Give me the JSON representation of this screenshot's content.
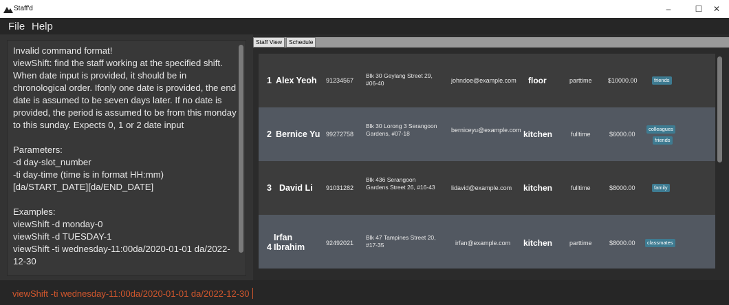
{
  "window": {
    "title": "Staff'd",
    "controls": [
      "–",
      "☐",
      "✕"
    ]
  },
  "menu": {
    "items": [
      "File",
      "Help"
    ]
  },
  "result": {
    "text": "Invalid command format!\nviewShift: find the staff working at the specified shift. When date input is provided, it should be in chronological order. Ifonly one date is provided, the end date is assumed to be seven days later. If no date is provided, the period is assumed to be from this monday to this sunday. Expects 0, 1 or 2 date input\n\nParameters:\n-d day-slot_number\n-ti day-time (time is in format HH:mm)[da/START_DATE][da/END_DATE]\n\nExamples:\nviewShift -d monday-0\nviewShift -d TUESDAY-1\nviewShift -ti wednesday-11:00da/2020-01-01 da/2022-12-30"
  },
  "tabs": [
    {
      "label": "Staff View"
    },
    {
      "label": "Schedule"
    }
  ],
  "staff": [
    {
      "index": "1",
      "name": "Alex Yeoh",
      "phone": "91234567",
      "address": "Blk 30 Geylang Street 29, #06-40",
      "email": "johndoe@example.com",
      "role": "floor",
      "type": "parttime",
      "salary": "$10000.00",
      "tags": [
        "friends"
      ]
    },
    {
      "index": "2",
      "name": "Bernice Yu",
      "phone": "99272758",
      "address": "Blk 30 Lorong 3 Serangoon Gardens, #07-18",
      "email": "berniceyu@example.com",
      "role": "kitchen",
      "type": "fulltime",
      "salary": "$6000.00",
      "tags": [
        "colleagues",
        "friends"
      ]
    },
    {
      "index": "3",
      "name": "David Li",
      "phone": "91031282",
      "address": "Blk 436 Serangoon Gardens Street 26, #16-43",
      "email": "lidavid@example.com",
      "role": "kitchen",
      "type": "fulltime",
      "salary": "$8000.00",
      "tags": [
        "family"
      ]
    },
    {
      "index": "4",
      "name": "Irfan Ibrahim",
      "phone": "92492021",
      "address": "Blk 47 Tampines Street 20, #17-35",
      "email": "irfan@example.com",
      "role": "kitchen",
      "type": "parttime",
      "salary": "$8000.00",
      "tags": [
        "classmates"
      ]
    }
  ],
  "command": {
    "value": "viewShift -ti wednesday-11:00da/2020-01-01 da/2022-12-30"
  },
  "icons": {
    "app": "mountain-logo-icon"
  }
}
